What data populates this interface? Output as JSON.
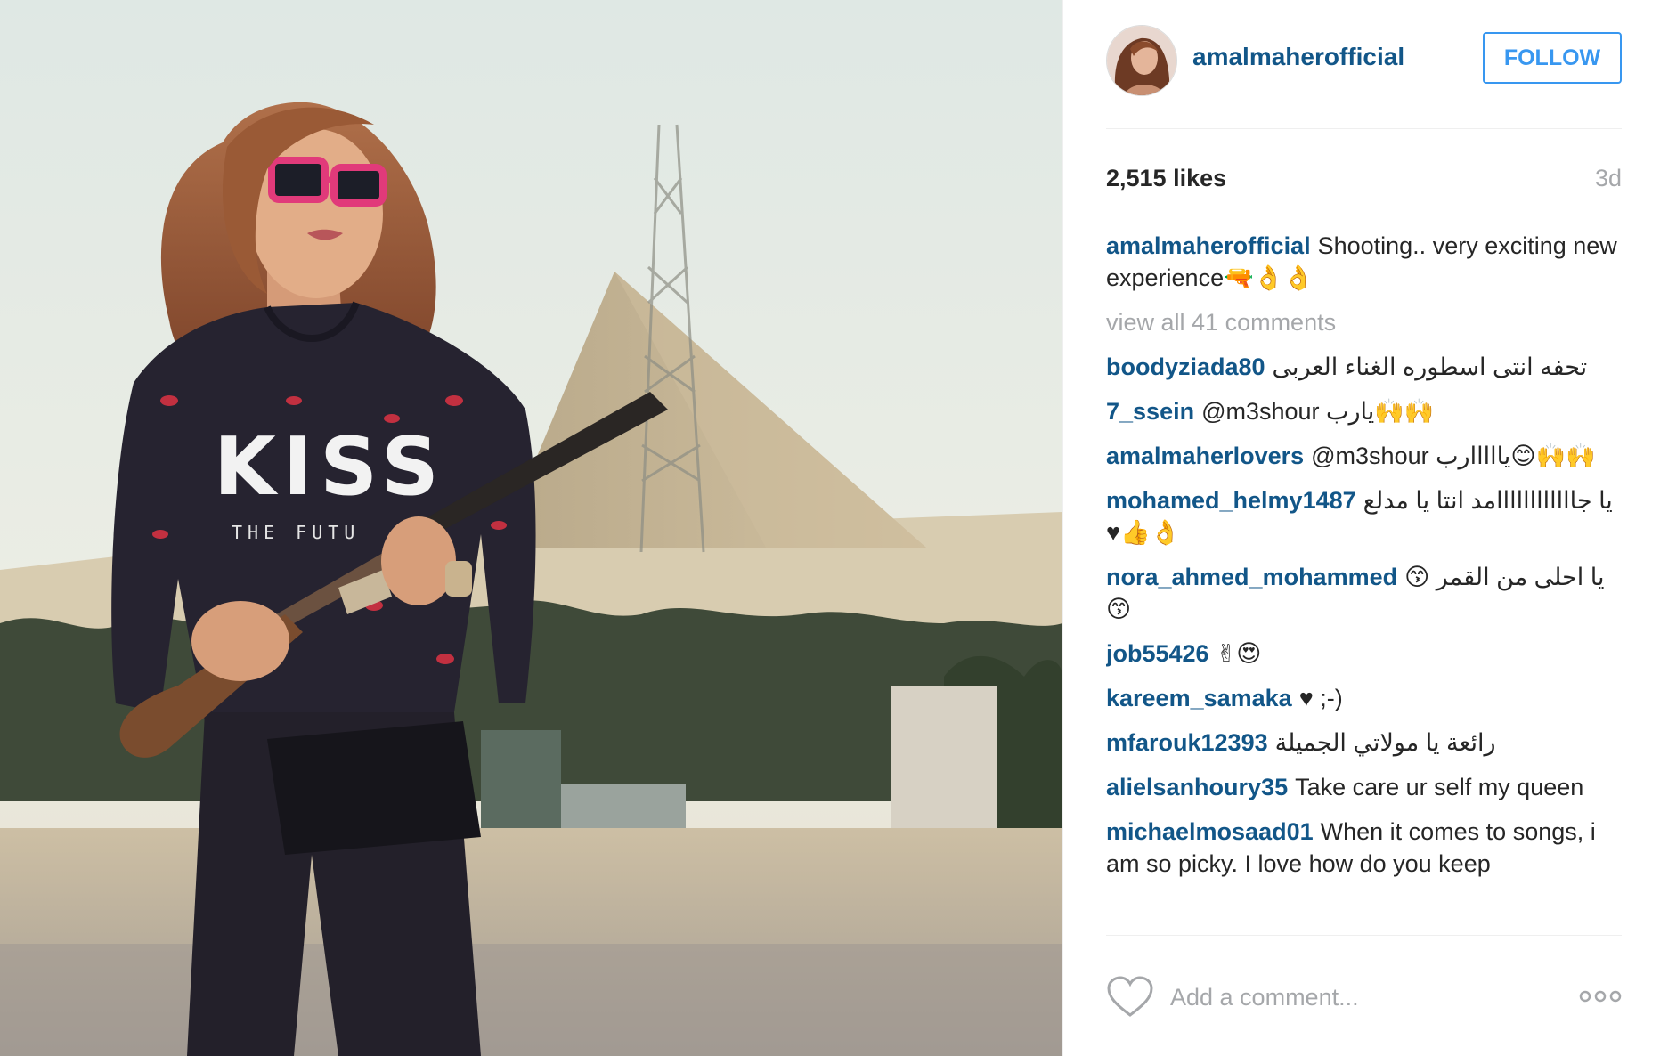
{
  "post": {
    "image_alt": "",
    "header": {
      "username": "amalmaherofficial",
      "follow_label": "FOLLOW",
      "avatar_icon": "profile-photo"
    },
    "likes": "2,515 likes",
    "age": "3d",
    "caption": {
      "username": "amalmaherofficial",
      "text": "Shooting.. very exciting new experience🔫👌👌"
    },
    "view_all": "view all 41 comments",
    "comments": [
      {
        "user": "boodyziada80",
        "text": "تحفه انتى اسطوره الغناء العربى"
      },
      {
        "user": "7_ssein",
        "text": "@m3shour يارب🙌🙌"
      },
      {
        "user": "amalmaherlovers",
        "text": "@m3shour يااااارب😊🙌🙌"
      },
      {
        "user": "mohamed_helmy1487",
        "text": "يا جاااااااااااامد انتا يا مدلع 👌👍♥"
      },
      {
        "user": "nora_ahmed_mohammed",
        "text": "يا احلى من القمر 😙😙"
      },
      {
        "user": "job55426",
        "text": "✌😍"
      },
      {
        "user": "kareem_samaka",
        "text": "♥ ;-)"
      },
      {
        "user": "mfarouk12393",
        "text": "رائعة يا مولاتي الجميلة"
      },
      {
        "user": "alielsanhoury35",
        "text": "Take care ur self my queen"
      },
      {
        "user": "michaelmosaad01",
        "text": "When it comes to songs, i am so picky. I love how do you keep"
      }
    ],
    "footer": {
      "comment_placeholder": "Add a comment...",
      "like_icon": "heart-icon",
      "more_icon": "more-options-icon"
    },
    "colors": {
      "username": "#125688",
      "follow_border": "#3897f0",
      "muted": "#a5a7aa",
      "text": "#262626"
    }
  }
}
